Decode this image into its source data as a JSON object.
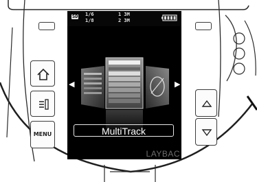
{
  "status_bar": {
    "storage": "SD",
    "rec_format_top": "1/6",
    "rec_format_bottom": "1/8",
    "mic_top": "1 3M",
    "mic_bottom": "2 3M",
    "battery": "battery-full"
  },
  "carousel": {
    "left_arrow": "◀",
    "right_arrow": "▶",
    "selected_mode": "MultiTrack"
  },
  "ticker_text": "LAYBAC",
  "buttons": {
    "menu_label": "MENU",
    "home_icon": "home-icon",
    "list_icon": "list-icon",
    "up_icon": "triangle-up-icon",
    "down_icon": "triangle-down-icon"
  }
}
